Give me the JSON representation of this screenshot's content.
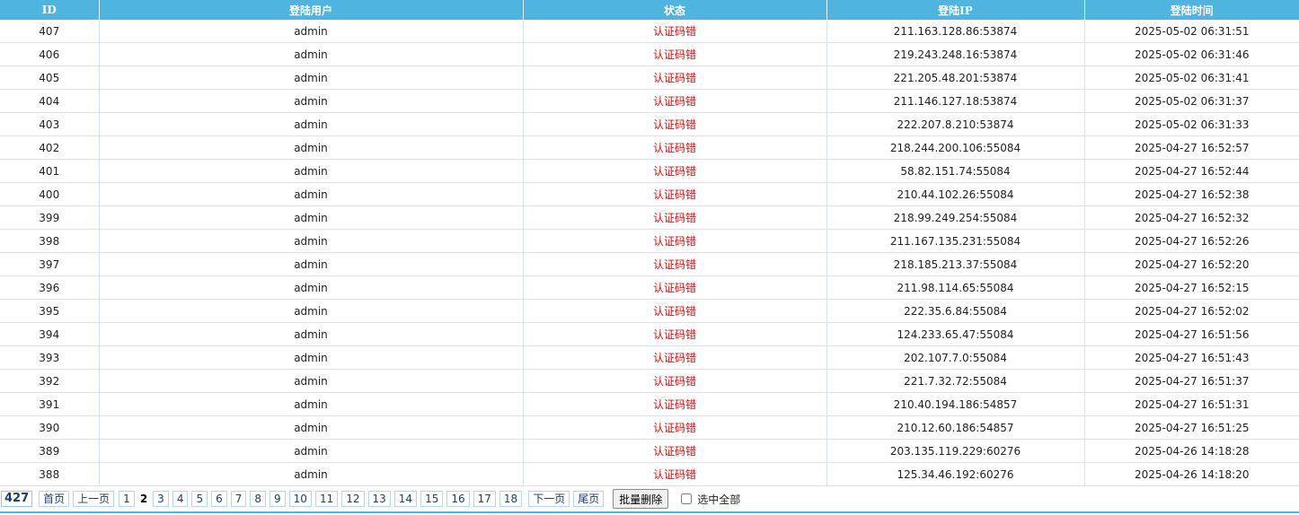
{
  "table": {
    "headers": [
      "ID",
      "登陆用户",
      "状态",
      "登陆IP",
      "登陆时间"
    ],
    "rows": [
      {
        "id": "407",
        "user": "admin",
        "status": "认证码错",
        "ip": "211.163.128.86:53874",
        "time": "2025-05-02 06:31:51"
      },
      {
        "id": "406",
        "user": "admin",
        "status": "认证码错",
        "ip": "219.243.248.16:53874",
        "time": "2025-05-02 06:31:46"
      },
      {
        "id": "405",
        "user": "admin",
        "status": "认证码错",
        "ip": "221.205.48.201:53874",
        "time": "2025-05-02 06:31:41"
      },
      {
        "id": "404",
        "user": "admin",
        "status": "认证码错",
        "ip": "211.146.127.18:53874",
        "time": "2025-05-02 06:31:37"
      },
      {
        "id": "403",
        "user": "admin",
        "status": "认证码错",
        "ip": "222.207.8.210:53874",
        "time": "2025-05-02 06:31:33"
      },
      {
        "id": "402",
        "user": "admin",
        "status": "认证码错",
        "ip": "218.244.200.106:55084",
        "time": "2025-04-27 16:52:57"
      },
      {
        "id": "401",
        "user": "admin",
        "status": "认证码错",
        "ip": "58.82.151.74:55084",
        "time": "2025-04-27 16:52:44"
      },
      {
        "id": "400",
        "user": "admin",
        "status": "认证码错",
        "ip": "210.44.102.26:55084",
        "time": "2025-04-27 16:52:38"
      },
      {
        "id": "399",
        "user": "admin",
        "status": "认证码错",
        "ip": "218.99.249.254:55084",
        "time": "2025-04-27 16:52:32"
      },
      {
        "id": "398",
        "user": "admin",
        "status": "认证码错",
        "ip": "211.167.135.231:55084",
        "time": "2025-04-27 16:52:26"
      },
      {
        "id": "397",
        "user": "admin",
        "status": "认证码错",
        "ip": "218.185.213.37:55084",
        "time": "2025-04-27 16:52:20"
      },
      {
        "id": "396",
        "user": "admin",
        "status": "认证码错",
        "ip": "211.98.114.65:55084",
        "time": "2025-04-27 16:52:15"
      },
      {
        "id": "395",
        "user": "admin",
        "status": "认证码错",
        "ip": "222.35.6.84:55084",
        "time": "2025-04-27 16:52:02"
      },
      {
        "id": "394",
        "user": "admin",
        "status": "认证码错",
        "ip": "124.233.65.47:55084",
        "time": "2025-04-27 16:51:56"
      },
      {
        "id": "393",
        "user": "admin",
        "status": "认证码错",
        "ip": "202.107.7.0:55084",
        "time": "2025-04-27 16:51:43"
      },
      {
        "id": "392",
        "user": "admin",
        "status": "认证码错",
        "ip": "221.7.32.72:55084",
        "time": "2025-04-27 16:51:37"
      },
      {
        "id": "391",
        "user": "admin",
        "status": "认证码错",
        "ip": "210.40.194.186:54857",
        "time": "2025-04-27 16:51:31"
      },
      {
        "id": "390",
        "user": "admin",
        "status": "认证码错",
        "ip": "210.12.60.186:54857",
        "time": "2025-04-27 16:51:25"
      },
      {
        "id": "389",
        "user": "admin",
        "status": "认证码错",
        "ip": "203.135.119.229:60276",
        "time": "2025-04-26 14:18:28"
      },
      {
        "id": "388",
        "user": "admin",
        "status": "认证码错",
        "ip": "125.34.46.192:60276",
        "time": "2025-04-26 14:18:20"
      }
    ]
  },
  "pagination": {
    "total": "427",
    "first": "首页",
    "prev": "上一页",
    "pages": [
      "1",
      "2",
      "3",
      "4",
      "5",
      "6",
      "7",
      "8",
      "9",
      "10",
      "11",
      "12",
      "13",
      "14",
      "15",
      "16",
      "17",
      "18"
    ],
    "current": "2",
    "next": "下一页",
    "last": "尾页"
  },
  "actions": {
    "batch_delete": "批量删除",
    "select_all": "选中全部",
    "select_all_checked": false
  },
  "colors": {
    "header_bg": "#4fb4e0",
    "header_text": "#ffffff",
    "status_text": "#ff0000",
    "grid_line": "#cfe7f2"
  }
}
